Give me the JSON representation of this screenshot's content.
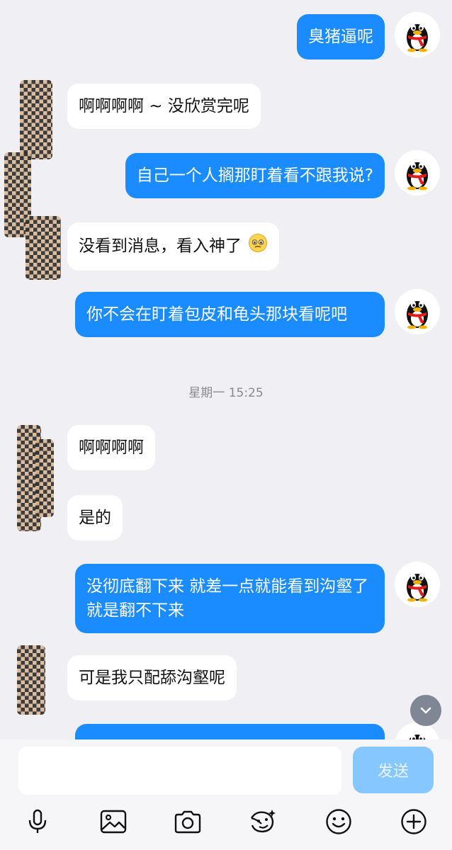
{
  "messages": [
    {
      "from": "me",
      "text": "臭猪逼呢"
    },
    {
      "from": "them",
      "text": "啊啊啊啊 ~ 没欣赏完呢"
    },
    {
      "from": "me",
      "text": "自己一个人搁那盯着看不跟我说?"
    },
    {
      "from": "them",
      "text": "没看到消息，看入神了",
      "emoji": "pleading-face"
    },
    {
      "from": "me",
      "text": "你不会在盯着包皮和龟头那块看呢吧"
    },
    {
      "from": "them",
      "text": "啊啊啊啊"
    },
    {
      "from": "them",
      "text": "是的"
    },
    {
      "from": "me",
      "text": "没彻底翻下来 就差一点就能看到沟壑了 就是翻不下来"
    },
    {
      "from": "them",
      "text": "可是我只配舔沟壑呢"
    }
  ],
  "timestamp": "星期一 15:25",
  "input": {
    "value": "",
    "send_label": "发送"
  },
  "toolbar": [
    "microphone-icon",
    "image-icon",
    "camera-icon",
    "sticker-icon",
    "emoji-icon",
    "plus-icon"
  ],
  "colors": {
    "my_bubble": "#1a8cff",
    "their_bubble": "#ffffff",
    "background": "#efeff4",
    "send_button": "#86c7ff"
  }
}
